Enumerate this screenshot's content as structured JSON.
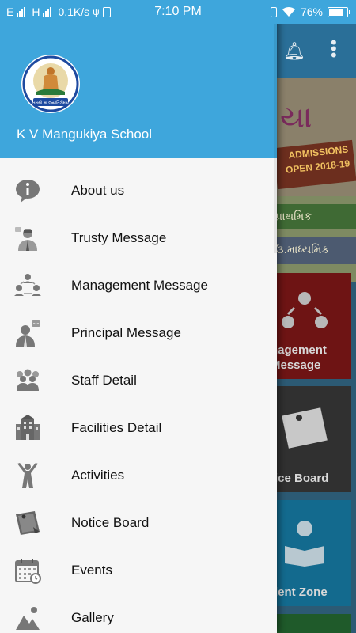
{
  "status_bar": {
    "carrier_left": "E",
    "carrier_mid": "H",
    "network_speed": "0.1K/s",
    "time": "7:10 PM",
    "battery_percent": "76%",
    "battery_level": 0.76,
    "icons": [
      "signal-icon",
      "signal-icon",
      "usb-icon",
      "sim-icon",
      "vibrate-icon",
      "wifi-icon",
      "battery-icon"
    ]
  },
  "drawer": {
    "header_color": "#3ea6dc",
    "logo_motto": "તમસો મા જ્યોતિર્ગમય",
    "school_name": "K V Mangukiya School",
    "menu": [
      {
        "label": "About us",
        "icon": "info-icon"
      },
      {
        "label": "Trusty Message",
        "icon": "trustee-icon"
      },
      {
        "label": "Management Message",
        "icon": "management-icon"
      },
      {
        "label": "Principal Message",
        "icon": "principal-icon"
      },
      {
        "label": "Staff Detail",
        "icon": "staff-icon"
      },
      {
        "label": "Facilities Detail",
        "icon": "building-icon"
      },
      {
        "label": "Activities",
        "icon": "activities-icon"
      },
      {
        "label": "Notice Board",
        "icon": "notice-icon"
      },
      {
        "label": "Events",
        "icon": "calendar-icon"
      },
      {
        "label": "Gallery",
        "icon": "gallery-icon"
      }
    ]
  },
  "background": {
    "banner": {
      "title_fragment": "યા",
      "admissions": "ADMISSIONS",
      "open": "OPEN 2018-19",
      "line1": "પ્રાથમિક",
      "line2": "ઉ.માધ્યમિક"
    },
    "tiles": [
      {
        "label": "nagement\nMessage",
        "color": "#6e1414"
      },
      {
        "label": "tice Board",
        "color": "#303030"
      },
      {
        "label": "dent Zone",
        "color": "#136a8e"
      }
    ]
  }
}
